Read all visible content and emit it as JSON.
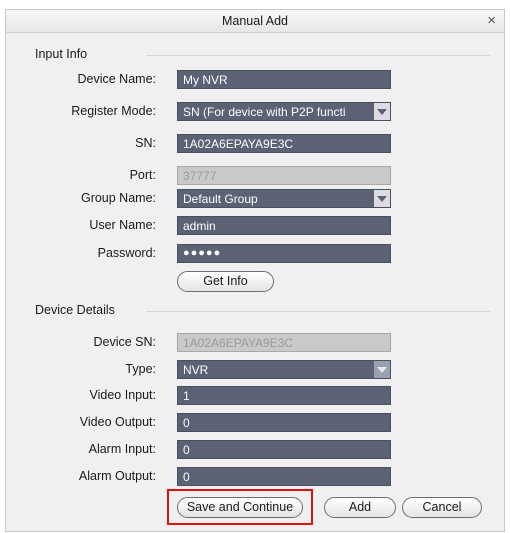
{
  "dialog": {
    "title": "Manual Add",
    "close_glyph": "×"
  },
  "input_info": {
    "heading": "Input Info",
    "device_name": {
      "label": "Device Name:",
      "value": "My NVR"
    },
    "register_mode": {
      "label": "Register Mode:",
      "value": "SN (For device with P2P functi"
    },
    "sn": {
      "label": "SN:",
      "value": "1A02A6EPAYA9E3C"
    },
    "port": {
      "label": "Port:",
      "value": "37777"
    },
    "group_name": {
      "label": "Group Name:",
      "value": "Default Group"
    },
    "user_name": {
      "label": "User Name:",
      "value": "admin"
    },
    "password": {
      "label": "Password:",
      "value": "●●●●●"
    },
    "get_info_label": "Get Info"
  },
  "device_details": {
    "heading": "Device Details",
    "device_sn": {
      "label": "Device SN:",
      "value": "1A02A6EPAYA9E3C"
    },
    "type": {
      "label": "Type:",
      "value": "NVR"
    },
    "video_input": {
      "label": "Video Input:",
      "value": "1"
    },
    "video_output": {
      "label": "Video Output:",
      "value": "0"
    },
    "alarm_input": {
      "label": "Alarm Input:",
      "value": "0"
    },
    "alarm_output": {
      "label": "Alarm Output:",
      "value": "0"
    }
  },
  "footer": {
    "save_continue_label": "Save and Continue",
    "add_label": "Add",
    "cancel_label": "Cancel"
  },
  "colors": {
    "field_bg": "#5a6274",
    "highlight": "#e01010",
    "disabled_bg": "#c9c9c9"
  },
  "icons": {
    "close": "close-icon",
    "dropdown": "chevron-down-icon"
  }
}
